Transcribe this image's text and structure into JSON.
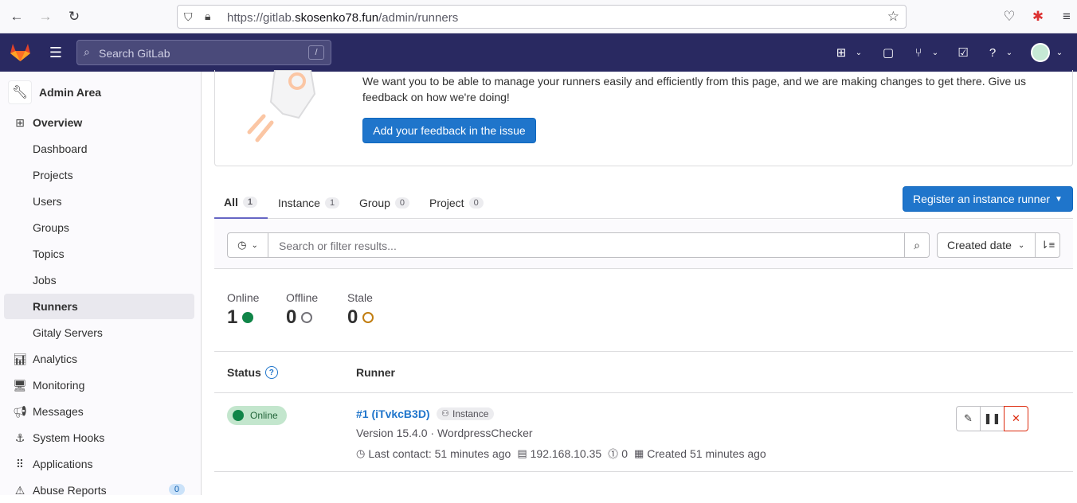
{
  "browser": {
    "url_prefix": "https://gitlab.",
    "url_domain": "skosenko78.fun",
    "url_path": "/admin/runners"
  },
  "topnav": {
    "search_placeholder": "Search GitLab",
    "search_shortcut": "/"
  },
  "sidebar": {
    "title": "Admin Area",
    "items": [
      {
        "label": "Overview",
        "icon": "overview-icon"
      },
      {
        "label": "Dashboard"
      },
      {
        "label": "Projects"
      },
      {
        "label": "Users"
      },
      {
        "label": "Groups"
      },
      {
        "label": "Topics"
      },
      {
        "label": "Jobs"
      },
      {
        "label": "Runners"
      },
      {
        "label": "Gitaly Servers"
      },
      {
        "label": "Analytics",
        "icon": "analytics-icon"
      },
      {
        "label": "Monitoring",
        "icon": "monitoring-icon"
      },
      {
        "label": "Messages",
        "icon": "messages-icon"
      },
      {
        "label": "System Hooks",
        "icon": "hook-icon"
      },
      {
        "label": "Applications",
        "icon": "applications-icon"
      },
      {
        "label": "Abuse Reports",
        "icon": "abuse-icon",
        "badge": "0"
      }
    ]
  },
  "banner": {
    "text": "We want you to be able to manage your runners easily and efficiently from this page, and we are making changes to get there. Give us feedback on how we're doing!",
    "button": "Add your feedback in the issue"
  },
  "tabs": [
    {
      "label": "All",
      "count": "1"
    },
    {
      "label": "Instance",
      "count": "1"
    },
    {
      "label": "Group",
      "count": "0"
    },
    {
      "label": "Project",
      "count": "0"
    }
  ],
  "register_button": "Register an instance runner",
  "filter": {
    "placeholder": "Search or filter results...",
    "sort_label": "Created date"
  },
  "stats": [
    {
      "label": "Online",
      "value": "1",
      "color": "#108548"
    },
    {
      "label": "Offline",
      "value": "0",
      "color": "#737278"
    },
    {
      "label": "Stale",
      "value": "0",
      "color": "#c17d10"
    }
  ],
  "table": {
    "col_status": "Status",
    "col_runner": "Runner"
  },
  "runner": {
    "status": "Online",
    "name": "#1 (iTvkcB3D)",
    "type": "Instance",
    "version": "Version 15.4.0 · WordpressChecker",
    "last_contact": "Last contact: 51 minutes ago",
    "ip": "192.168.10.35",
    "jobs": "0",
    "created": "Created 51 minutes ago"
  }
}
